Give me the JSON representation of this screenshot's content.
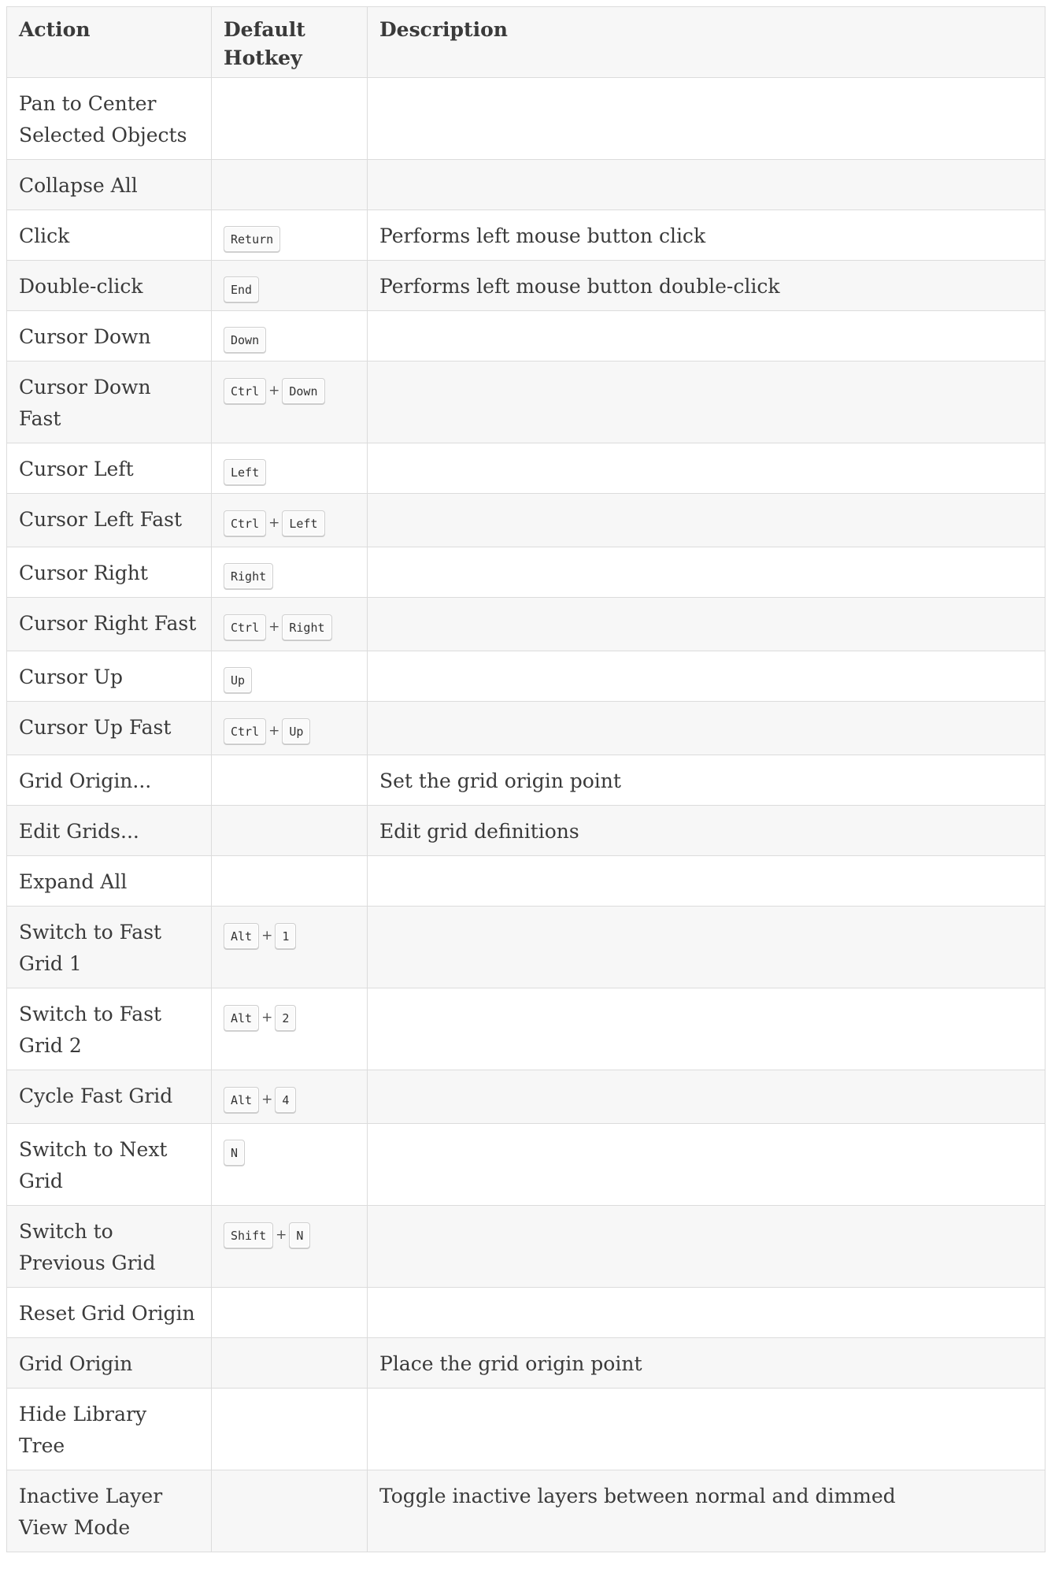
{
  "table": {
    "headers": {
      "action": "Action",
      "hotkey": "Default Hotkey",
      "description": "Description"
    },
    "plus": "+",
    "rows": [
      {
        "action": "Pan to Center Selected Objects",
        "keys": [],
        "description": ""
      },
      {
        "action": "Collapse All",
        "keys": [],
        "description": ""
      },
      {
        "action": "Click",
        "keys": [
          "Return"
        ],
        "description": "Performs left mouse button click"
      },
      {
        "action": "Double-click",
        "keys": [
          "End"
        ],
        "description": "Performs left mouse button double-click"
      },
      {
        "action": "Cursor Down",
        "keys": [
          "Down"
        ],
        "description": ""
      },
      {
        "action": "Cursor Down Fast",
        "keys": [
          "Ctrl",
          "Down"
        ],
        "description": ""
      },
      {
        "action": "Cursor Left",
        "keys": [
          "Left"
        ],
        "description": ""
      },
      {
        "action": "Cursor Left Fast",
        "keys": [
          "Ctrl",
          "Left"
        ],
        "description": ""
      },
      {
        "action": "Cursor Right",
        "keys": [
          "Right"
        ],
        "description": ""
      },
      {
        "action": "Cursor Right Fast",
        "keys": [
          "Ctrl",
          "Right"
        ],
        "description": ""
      },
      {
        "action": "Cursor Up",
        "keys": [
          "Up"
        ],
        "description": ""
      },
      {
        "action": "Cursor Up Fast",
        "keys": [
          "Ctrl",
          "Up"
        ],
        "description": ""
      },
      {
        "action": "Grid Origin...",
        "keys": [],
        "description": "Set the grid origin point"
      },
      {
        "action": "Edit Grids...",
        "keys": [],
        "description": "Edit grid definitions"
      },
      {
        "action": "Expand All",
        "keys": [],
        "description": ""
      },
      {
        "action": "Switch to Fast Grid 1",
        "keys": [
          "Alt",
          "1"
        ],
        "description": ""
      },
      {
        "action": "Switch to Fast Grid 2",
        "keys": [
          "Alt",
          "2"
        ],
        "description": ""
      },
      {
        "action": "Cycle Fast Grid",
        "keys": [
          "Alt",
          "4"
        ],
        "description": ""
      },
      {
        "action": "Switch to Next Grid",
        "keys": [
          "N"
        ],
        "description": ""
      },
      {
        "action": "Switch to Previous Grid",
        "keys": [
          "Shift",
          "N"
        ],
        "description": ""
      },
      {
        "action": "Reset Grid Origin",
        "keys": [],
        "description": ""
      },
      {
        "action": "Grid Origin",
        "keys": [],
        "description": "Place the grid origin point"
      },
      {
        "action": "Hide Library Tree",
        "keys": [],
        "description": ""
      },
      {
        "action": "Inactive Layer View Mode",
        "keys": [],
        "description": "Toggle inactive layers between normal and dimmed"
      }
    ]
  }
}
